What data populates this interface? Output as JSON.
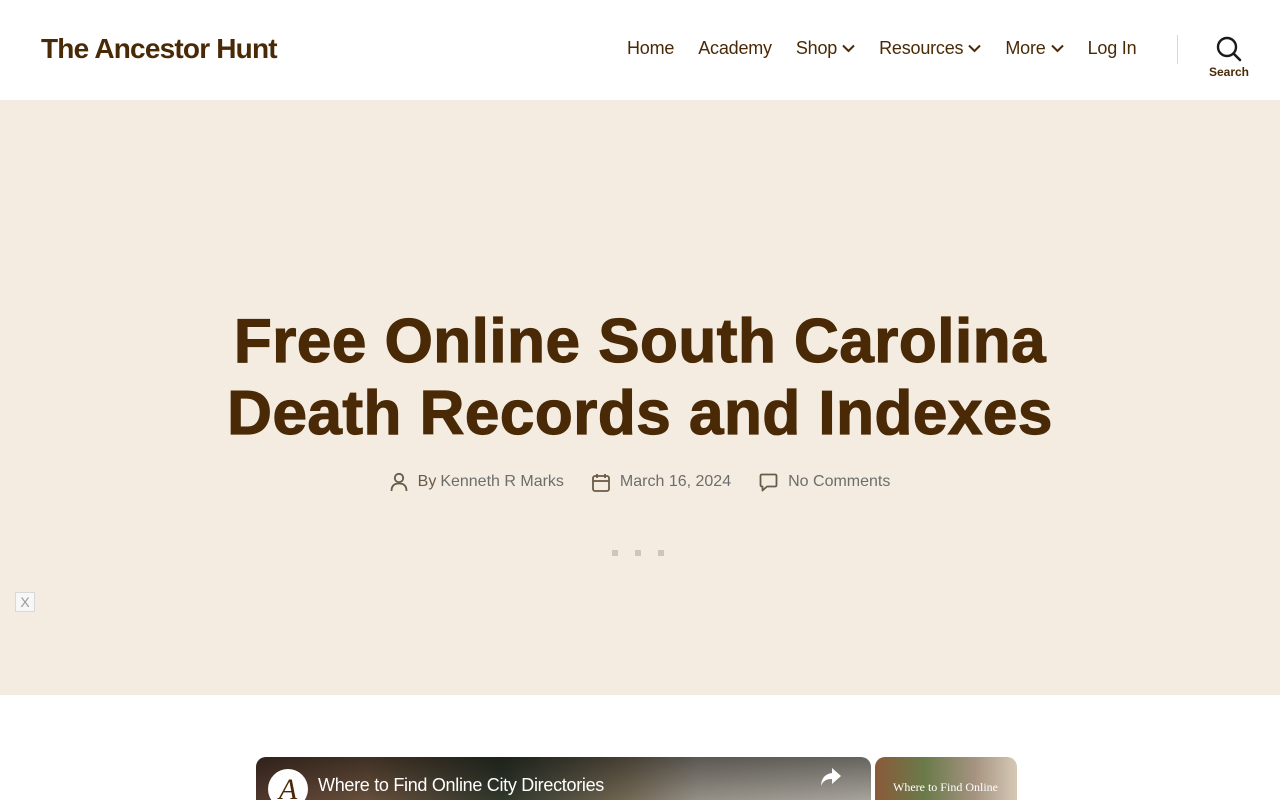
{
  "site": {
    "title": "The Ancestor Hunt"
  },
  "nav": {
    "items": [
      {
        "label": "Home",
        "has_submenu": false
      },
      {
        "label": "Academy",
        "has_submenu": false
      },
      {
        "label": "Shop",
        "has_submenu": true
      },
      {
        "label": "Resources",
        "has_submenu": true
      },
      {
        "label": "More",
        "has_submenu": true
      },
      {
        "label": "Log In",
        "has_submenu": false
      }
    ],
    "search_label": "Search"
  },
  "post": {
    "title_line1": "Free Online South Carolina",
    "title_line2": "Death Records and Indexes",
    "author_prefix": "By",
    "author": "Kenneth R Marks",
    "date": "March 16, 2024",
    "comments": "No Comments"
  },
  "ad": {
    "close_label": "X"
  },
  "video": {
    "main_title": "Where to Find Online City Directories",
    "side_title": "Where to Find Online"
  },
  "colors": {
    "brand_brown": "#4a2a06",
    "hero_bg": "#f4ece0",
    "meta_text": "#6a5a48"
  },
  "icons": {
    "author": "person-icon",
    "date": "calendar-icon",
    "comments": "comment-icon",
    "search": "search-icon",
    "submenu": "chevron-down-icon",
    "share": "share-icon"
  }
}
